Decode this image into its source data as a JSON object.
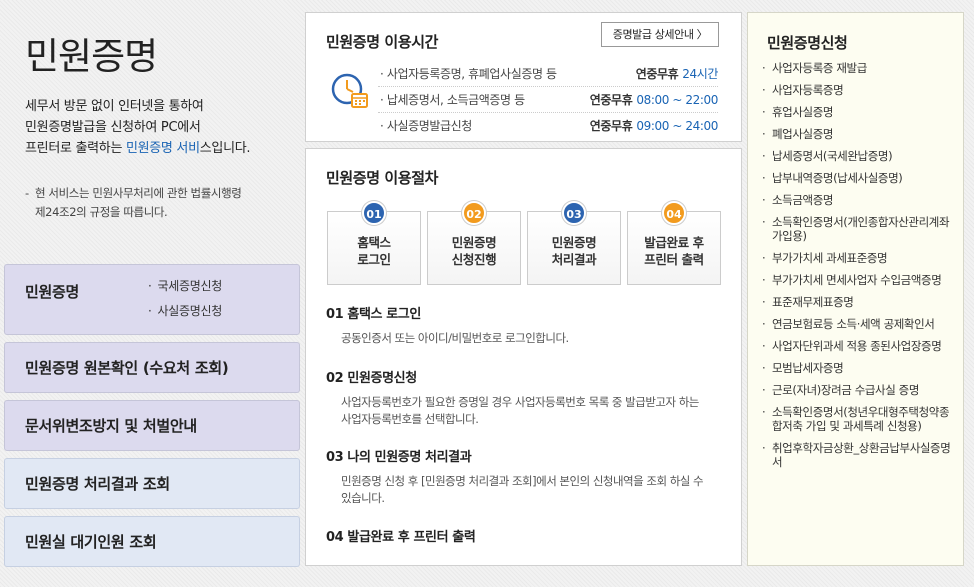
{
  "left": {
    "title": "민원증명",
    "intro_lines": [
      "세무서 방문 없이 인터넷을 통하여",
      "민원증명발급을 신청하여 PC에서"
    ],
    "intro_line3_prefix": "프린터로 출력하는 ",
    "intro_line3_highlight": "민원증명 서비",
    "intro_line3_suffix": "스입니다.",
    "notice_dash": "-",
    "notice_lines": [
      "현 서비스는 민원사무처리에 관한 법률시행령",
      "제24조2의 규정을 따릅니다."
    ],
    "menu": {
      "main_label": "민원증명",
      "sub_bullet": "·",
      "sub_items": [
        "국세증명신청",
        "사실증명신청"
      ],
      "items": [
        "민원증명 원본확인 (수요처 조회)",
        "문서위변조방지 및 처벌안내",
        "민원증명 처리결과 조회",
        "민원실 대기인원 조회"
      ]
    }
  },
  "hours": {
    "title": "민원증명 이용시간",
    "detail_button": "증명발급 상세안내 〉",
    "icon": "clock-calendar-icon",
    "rows": [
      {
        "name": "· 사업자등록증명, 휴폐업사실증명 등",
        "label": "연중무휴",
        "value": "24시간"
      },
      {
        "name": "· 납세증명서, 소득금액증명 등",
        "label": "연중무휴",
        "value": "08:00 ~ 22:00"
      },
      {
        "name": "· 사실증명발급신청",
        "label": "연중무휴",
        "value": "09:00 ~ 24:00"
      }
    ]
  },
  "procedure": {
    "title": "민원증명 이용절차",
    "steps": [
      {
        "num": "01",
        "line1": "홈택스",
        "line2": "로그인"
      },
      {
        "num": "02",
        "line1": "민원증명",
        "line2": "신청진행"
      },
      {
        "num": "03",
        "line1": "민원증명",
        "line2": "처리결과"
      },
      {
        "num": "04",
        "line1": "발급완료 후",
        "line2": "프린터 출력"
      }
    ],
    "details": [
      {
        "title": "01 홈택스 로그인",
        "desc": "공동인증서 또는 아이디/비밀번호로 로그인합니다."
      },
      {
        "title": "02 민원증명신청",
        "desc": "사업자등록번호가 필요한 증명일 경우 사업자등록번호 목록 중 발급받고자 하는 사업자등록번호를 선택합니다."
      },
      {
        "title": "03 나의 민원증명 처리결과",
        "desc": "민원증명 신청 후 [민원증명 처리결과 조회]에서 본인의 신청내역을 조회 하실 수 있습니다."
      },
      {
        "title": "04 발급완료 후 프린터 출력",
        "desc": ""
      }
    ]
  },
  "apply": {
    "title": "민원증명신청",
    "items": [
      "사업자등록증 재발급",
      "사업자등록증명",
      "휴업사실증명",
      "폐업사실증명",
      "납세증명서(국세완납증명)",
      "납부내역증명(납세사실증명)",
      "소득금액증명",
      "소득확인증명서(개인종합자산관리계좌 가입용)",
      "부가가치세 과세표준증명",
      "부가가치세 면세사업자 수입금액증명",
      "표준재무제표증명",
      "연금보험료등 소득·세액 공제확인서",
      "사업자단위과세 적용 종된사업장증명",
      "모범납세자증명",
      "근로(자녀)장려금 수급사실 증명",
      "소득확인증명서(청년우대형주택청약종합저축 가입 및 과세특례 신청용)",
      "취업후학자금상환_상환금납부사실증명서"
    ]
  },
  "colors": {
    "blue": "#2d64b0",
    "orange": "#f29b1e",
    "link": "#1a64b4",
    "menu_purple": "#dcdaee",
    "menu_blue": "#e1e8f4"
  }
}
